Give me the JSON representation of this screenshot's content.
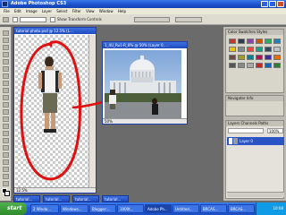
{
  "window": {
    "title": "Adobe Photoshop CS3"
  },
  "menu": {
    "items": [
      "File",
      "Edit",
      "Image",
      "Layer",
      "Select",
      "Filter",
      "View",
      "Window",
      "Help"
    ]
  },
  "options": {
    "mode_label": "Mode:",
    "mode_value": "Normal",
    "tolerance_label": "",
    "button_label": "Show Transform Controls"
  },
  "documents": {
    "cutout_title": "tutorial photo.psd @ 12.5% (L...",
    "cutout_zoom": "12.5%",
    "capitol_title": "1_4U_Ru1-R_8% @ 50% (Layer 0, ...",
    "capitol_zoom": "50%"
  },
  "panels": {
    "top_tabs": "Color  Swatches  Styles",
    "mid_tabs": "Navigator  Info",
    "layers_tabs": "Layers  Channels  Paths",
    "layer_name": "Layer 0",
    "opacity": "100%"
  },
  "colors": {
    "annotation": "#e01010",
    "title_blue": "#1f4bc0"
  },
  "taskbar": {
    "start_label": "start",
    "tasks": [
      "2 Windo...",
      "Windows...",
      "Blogger:...",
      "1000t...",
      "Adobe Ph...",
      "Untitled...",
      "BRCAS...",
      "BRCAS..."
    ],
    "clock": "10:08"
  },
  "minimized": [
    "tutorial...",
    "tutorial...",
    "tutorial...",
    "tutorial..."
  ]
}
